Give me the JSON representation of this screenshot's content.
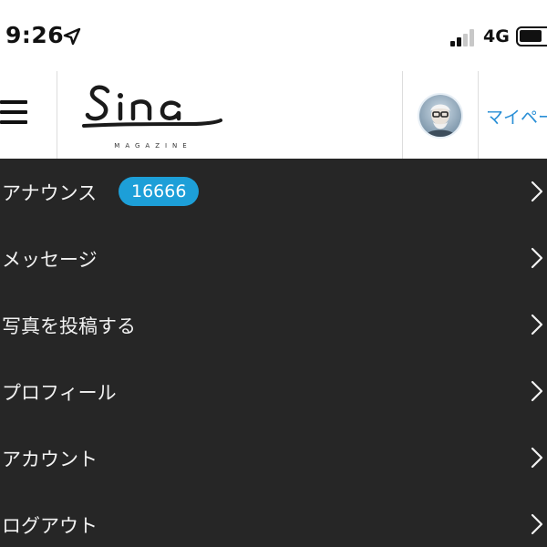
{
  "status_bar": {
    "time": "9:26",
    "network": "4G"
  },
  "header": {
    "logo_text": "Sina",
    "logo_subtitle": "MAGAZINE",
    "mypage_label": "マイペー"
  },
  "menu": {
    "items": [
      {
        "label": "アナウンス",
        "badge": "16666"
      },
      {
        "label": "メッセージ"
      },
      {
        "label": "写真を投稿する"
      },
      {
        "label": "プロフィール"
      },
      {
        "label": "アカウント"
      },
      {
        "label": "ログアウト"
      }
    ]
  },
  "colors": {
    "menu_background": "#262626",
    "badge": "#1d9fd8",
    "link": "#2a8fd6"
  }
}
